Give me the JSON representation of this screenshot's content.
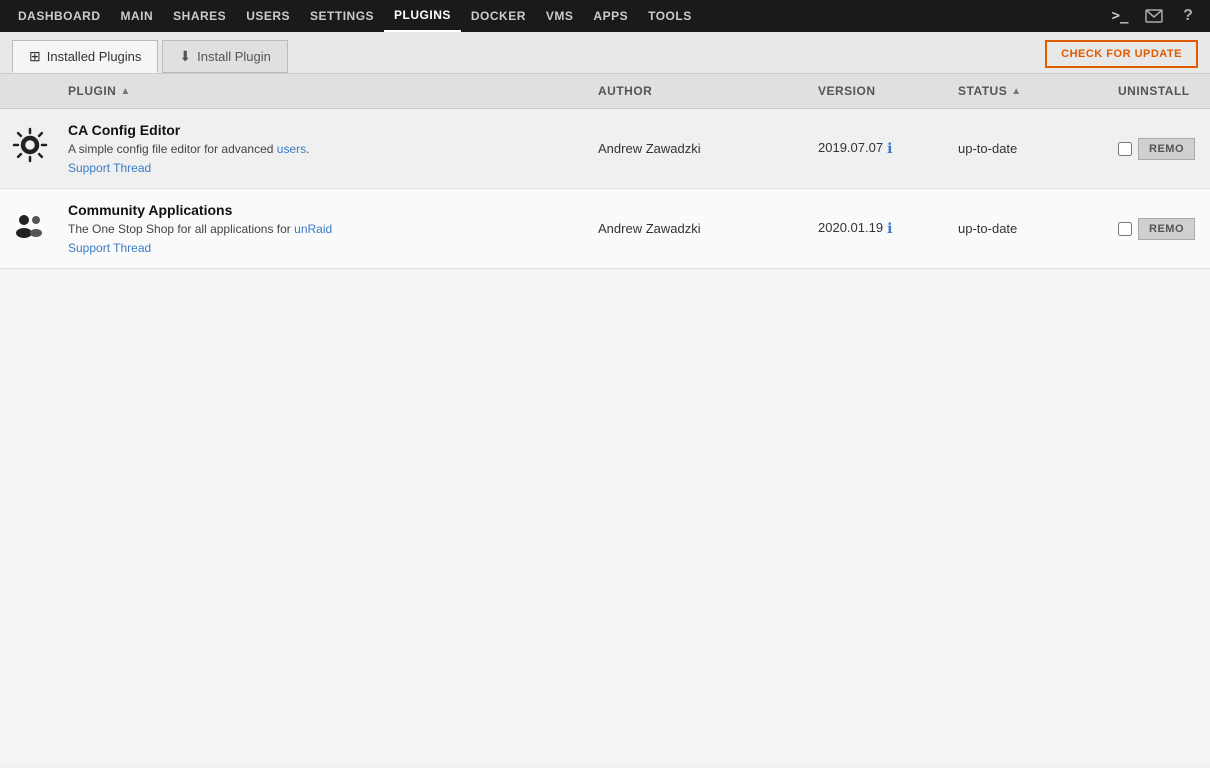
{
  "nav": {
    "items": [
      {
        "label": "DASHBOARD",
        "href": "#",
        "active": false
      },
      {
        "label": "MAIN",
        "href": "#",
        "active": false
      },
      {
        "label": "SHARES",
        "href": "#",
        "active": false
      },
      {
        "label": "USERS",
        "href": "#",
        "active": false
      },
      {
        "label": "SETTINGS",
        "href": "#",
        "active": false
      },
      {
        "label": "PLUGINS",
        "href": "#",
        "active": true
      },
      {
        "label": "DOCKER",
        "href": "#",
        "active": false
      },
      {
        "label": "VMS",
        "href": "#",
        "active": false
      },
      {
        "label": "APPS",
        "href": "#",
        "active": false
      },
      {
        "label": "TOOLS",
        "href": "#",
        "active": false
      }
    ],
    "icons": [
      {
        "name": "terminal-icon",
        "symbol": ">_"
      },
      {
        "name": "message-icon",
        "symbol": "✉"
      },
      {
        "name": "help-icon",
        "symbol": "?"
      }
    ]
  },
  "tabs": {
    "installed_label": "Installed Plugins",
    "install_label": "Install Plugin",
    "check_update_label": "CHECK FOR UPDATE"
  },
  "table": {
    "columns": [
      {
        "key": "icon",
        "label": ""
      },
      {
        "key": "plugin",
        "label": "PLUGIN",
        "sortable": true
      },
      {
        "key": "author",
        "label": "AUTHOR"
      },
      {
        "key": "version",
        "label": "VERSION"
      },
      {
        "key": "status",
        "label": "STATUS",
        "sortable": true
      },
      {
        "key": "uninstall",
        "label": "UNINSTALL"
      }
    ],
    "rows": [
      {
        "id": "ca-config-editor",
        "icon": "⚙",
        "name": "CA Config Editor",
        "description_parts": [
          {
            "text": "A simple config file editor for advanced "
          },
          {
            "text": "users",
            "highlight": true
          },
          {
            "text": "."
          }
        ],
        "description": "A simple config file editor for advanced users.",
        "support_link": "Support Thread",
        "author": "Andrew Zawadzki",
        "version": "2019.07.07",
        "status": "up-to-date",
        "uninstall_label": "REMO"
      },
      {
        "id": "community-applications",
        "icon": "👥",
        "name": "Community Applications",
        "description_parts": [
          {
            "text": "The One Stop Shop for all applications for "
          },
          {
            "text": "unRaid",
            "highlight": true
          }
        ],
        "description": "The One Stop Shop for all applications for unRaid",
        "support_link": "Support Thread",
        "author": "Andrew Zawadzki",
        "version": "2020.01.19",
        "status": "up-to-date",
        "uninstall_label": "REMO"
      }
    ]
  }
}
